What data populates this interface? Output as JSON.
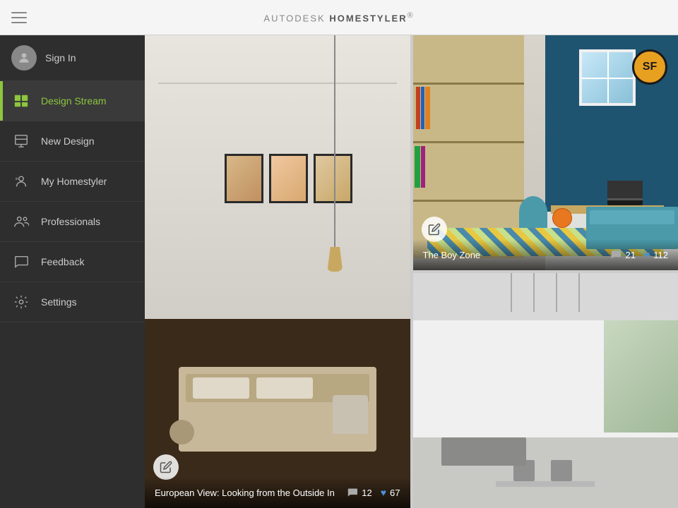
{
  "topbar": {
    "title_prefix": "AUTODESK",
    "title_brand": "HOMESTYLER",
    "trademark": "®"
  },
  "sidebar": {
    "sign_in_label": "Sign In",
    "items": [
      {
        "id": "design-stream",
        "label": "Design Stream",
        "active": true
      },
      {
        "id": "new-design",
        "label": "New Design",
        "active": false
      },
      {
        "id": "my-homestyler",
        "label": "My Homestyler",
        "active": false
      },
      {
        "id": "professionals",
        "label": "Professionals",
        "active": false
      },
      {
        "id": "feedback",
        "label": "Feedback",
        "active": false
      },
      {
        "id": "settings",
        "label": "Settings",
        "active": false
      }
    ]
  },
  "cards": {
    "large": {
      "title": "European View: Looking from the Outside In",
      "comments": "12",
      "likes": "67"
    },
    "top_right": {
      "title": "The Boy Zone",
      "comments": "21",
      "likes": "112"
    },
    "bottom_right": {
      "title": "",
      "comments": "",
      "likes": ""
    }
  }
}
